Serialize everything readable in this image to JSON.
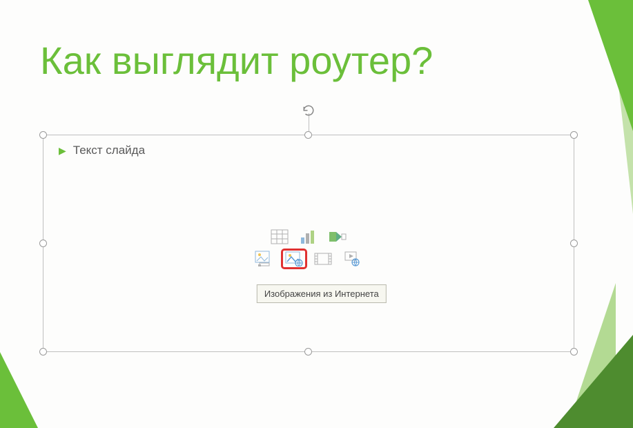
{
  "slide": {
    "title": "Как выглядит роутер?",
    "placeholder_text": "Текст слайда"
  },
  "tooltip": "Изображения из Интернета",
  "icons": {
    "table": "insert-table-icon",
    "chart": "insert-chart-icon",
    "smartart": "insert-smartart-icon",
    "picture": "insert-picture-icon",
    "online_picture": "insert-online-picture-icon",
    "video": "insert-video-icon",
    "online_video": "insert-online-video-icon"
  },
  "colors": {
    "accent": "#6bbf3a",
    "highlight": "#e03131"
  }
}
